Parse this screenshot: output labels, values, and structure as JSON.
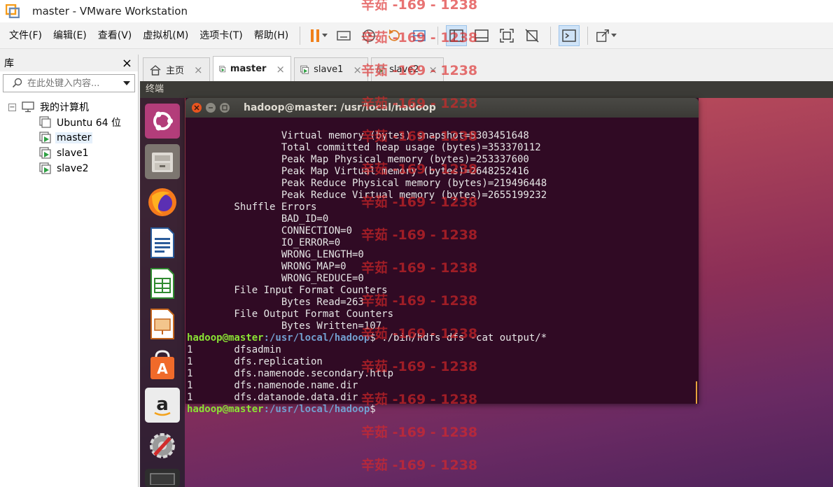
{
  "window": {
    "title": "master - VMware Workstation"
  },
  "menu": {
    "items": [
      "文件(F)",
      "编辑(E)",
      "查看(V)",
      "虚拟机(M)",
      "选项卡(T)",
      "帮助(H)"
    ]
  },
  "library": {
    "title": "库",
    "close": "×",
    "search_placeholder": "在此处键入内容...",
    "root_label": "我的计算机",
    "items": [
      "Ubuntu 64 位",
      "master",
      "slave1",
      "slave2"
    ],
    "selected": "master"
  },
  "tabs": [
    {
      "label": "主页",
      "close": "×",
      "icon": "home-icon"
    },
    {
      "label": "master",
      "close": "×",
      "icon": "vm-icon"
    },
    {
      "label": "slave1",
      "close": "×",
      "icon": "vm-icon"
    },
    {
      "label": "slave2",
      "close": "×",
      "icon": "vm-icon"
    }
  ],
  "vm": {
    "topbar_label": "终端",
    "terminal_title": "hadoop@master: /usr/local/hadoop",
    "lines": [
      "                Virtual memory (bytes) snapshot=5303451648",
      "                Total committed heap usage (bytes)=353370112",
      "                Peak Map Physical memory (bytes)=253337600",
      "                Peak Map Virtual memory (bytes)=2648252416",
      "                Peak Reduce Physical memory (bytes)=219496448",
      "                Peak Reduce Virtual memory (bytes)=2655199232",
      "        Shuffle Errors",
      "                BAD_ID=0",
      "                CONNECTION=0",
      "                IO_ERROR=0",
      "                WRONG_LENGTH=0",
      "                WRONG_MAP=0",
      "                WRONG_REDUCE=0",
      "        File Input Format Counters",
      "                Bytes Read=263",
      "        File Output Format Counters",
      "                Bytes Written=107"
    ],
    "prompt_user": "hadoop@master",
    "prompt_path": ":/usr/local/hadoop",
    "prompt_symbol": "$",
    "command": " ./bin/hdfs dfs -cat output/*",
    "output": [
      "1       dfsadmin",
      "1       dfs.replication",
      "1       dfs.namenode.secondary.http",
      "1       dfs.namenode.name.dir",
      "1       dfs.datanode.data.dir"
    ]
  },
  "watermark": "辛茹 -169 - 1238",
  "colors": {
    "terminal_bg": "#300a24",
    "prompt_user": "#8ae234",
    "prompt_path": "#729fcf",
    "accent": "#e6a23c"
  }
}
